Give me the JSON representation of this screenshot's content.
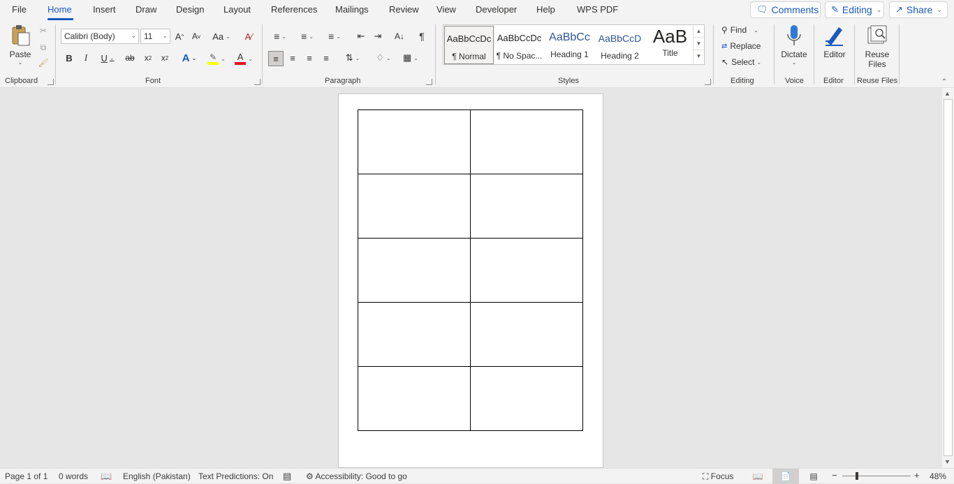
{
  "menubar": {
    "tabs": [
      "File",
      "Home",
      "Insert",
      "Draw",
      "Design",
      "Layout",
      "References",
      "Mailings",
      "Review",
      "View",
      "Developer",
      "Help",
      "WPS PDF"
    ],
    "active_tab": "Home",
    "comments_label": "Comments",
    "editing_label": "Editing",
    "share_label": "Share"
  },
  "ribbon": {
    "clipboard": {
      "paste_label": "Paste",
      "group_label": "Clipboard"
    },
    "font": {
      "font_name": "Calibri (Body)",
      "font_size": "11",
      "group_label": "Font",
      "highlight_color": "#ffff00",
      "font_color": "#e81123"
    },
    "paragraph": {
      "group_label": "Paragraph"
    },
    "styles": {
      "group_label": "Styles",
      "items": [
        {
          "preview": "AaBbCcDc",
          "name": "¶ Normal"
        },
        {
          "preview": "AaBbCcDc",
          "name": "¶ No Spac..."
        },
        {
          "preview": "AaBbCc",
          "name": "Heading 1"
        },
        {
          "preview": "AaBbCcD",
          "name": "Heading 2"
        },
        {
          "preview": "AaB",
          "name": "Title"
        }
      ]
    },
    "editing": {
      "find_label": "Find",
      "replace_label": "Replace",
      "select_label": "Select",
      "group_label": "Editing"
    },
    "voice": {
      "dictate_label": "Dictate",
      "group_label": "Voice"
    },
    "editor": {
      "editor_label": "Editor",
      "group_label": "Editor"
    },
    "reuse": {
      "label_line1": "Reuse",
      "label_line2": "Files",
      "group_label": "Reuse Files"
    }
  },
  "document": {
    "table_rows": 5,
    "table_cols": 2
  },
  "statusbar": {
    "page": "Page 1 of 1",
    "words": "0 words",
    "language": "English (Pakistan)",
    "text_predictions": "Text Predictions: On",
    "accessibility": "Accessibility: Good to go",
    "focus": "Focus",
    "zoom": "48%"
  },
  "colors": {
    "accent": "#185abd",
    "ribbon_bg": "#f3f3f3",
    "canvas_bg": "#e6e6e6"
  }
}
